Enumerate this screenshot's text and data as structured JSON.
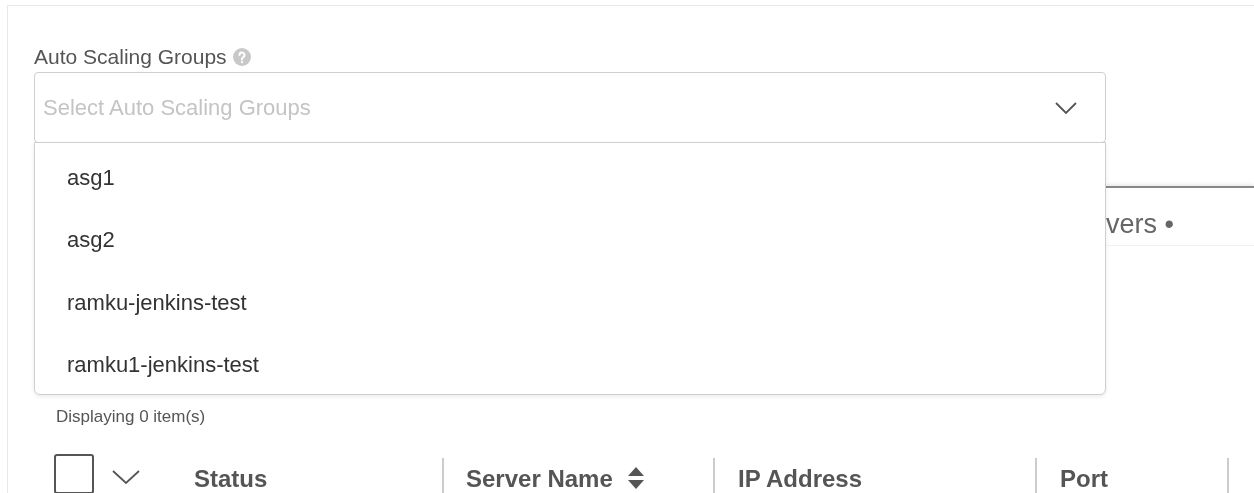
{
  "field": {
    "label": "Auto Scaling Groups",
    "placeholder": "Select Auto Scaling Groups"
  },
  "dropdown": {
    "options": [
      "asg1",
      "asg2",
      "ramku-jenkins-test",
      "ramku1-jenkins-test"
    ]
  },
  "background_panel": {
    "title_fragment": "vers •"
  },
  "table": {
    "count": "Displaying 0 item(s)",
    "select_all": {
      "checked": false
    },
    "columns": [
      {
        "label": "Status"
      },
      {
        "label": "Server Name",
        "sortable": true
      },
      {
        "label": "IP Address"
      },
      {
        "label": "Port"
      }
    ]
  }
}
